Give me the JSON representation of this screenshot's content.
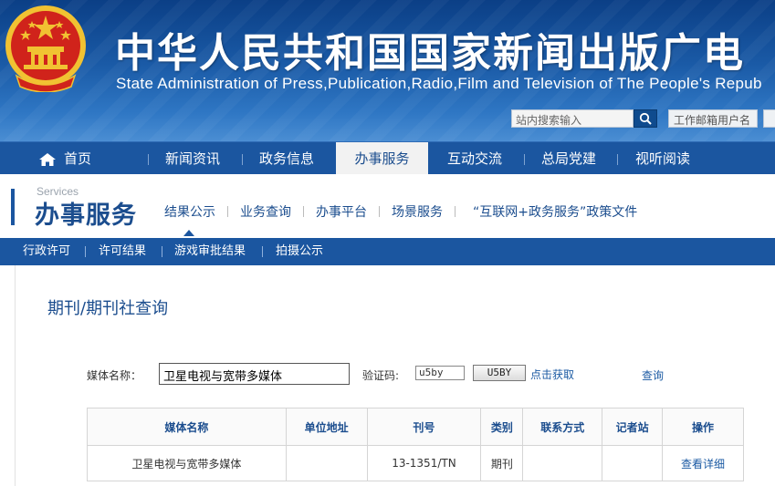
{
  "header": {
    "cn_title": "中华人民共和国国家新闻出版广电",
    "en_title": "State Administration of Press,Publication,Radio,Film and Television of The People's Repub",
    "search_placeholder": "站内搜索输入",
    "mail_label": "工作邮箱用户名"
  },
  "main_nav": {
    "items": [
      {
        "label": "首页"
      },
      {
        "label": "新闻资讯"
      },
      {
        "label": "政务信息"
      },
      {
        "label": "办事服务"
      },
      {
        "label": "互动交流"
      },
      {
        "label": "总局党建"
      },
      {
        "label": "视听阅读"
      }
    ],
    "active_index": 3
  },
  "section": {
    "en": "Services",
    "cn": "办事服务",
    "subnav": [
      {
        "label": "结果公示"
      },
      {
        "label": "业务查询"
      },
      {
        "label": "办事平台"
      },
      {
        "label": "场景服务"
      },
      {
        "label": "“互联网+政务服务”政策文件"
      }
    ]
  },
  "third_nav": {
    "items": [
      {
        "label": "行政许可"
      },
      {
        "label": "许可结果"
      },
      {
        "label": "游戏审批结果"
      },
      {
        "label": "拍摄公示"
      }
    ]
  },
  "content": {
    "title": "期刊/期刊社查询",
    "form": {
      "media_label": "媒体名称：",
      "media_value": "卫星电视与宽带多媒体",
      "captcha_label": "验证码:",
      "captcha_value": "u5by",
      "captcha_image_text": "U5BY",
      "refresh_link": "点击获取",
      "query_link": "查询"
    },
    "table": {
      "headers": [
        "媒体名称",
        "单位地址",
        "刊号",
        "类别",
        "联系方式",
        "记者站",
        "操作"
      ],
      "rows": [
        [
          "卫星电视与宽带多媒体",
          "",
          "13-1351/TN",
          "期刊",
          "",
          "",
          "查看详细"
        ]
      ]
    }
  },
  "colors": {
    "nav_blue": "#1b56a0",
    "title_blue": "#1b4d8e",
    "emblem_red": "#d0231b",
    "emblem_gold": "#f1c232"
  }
}
